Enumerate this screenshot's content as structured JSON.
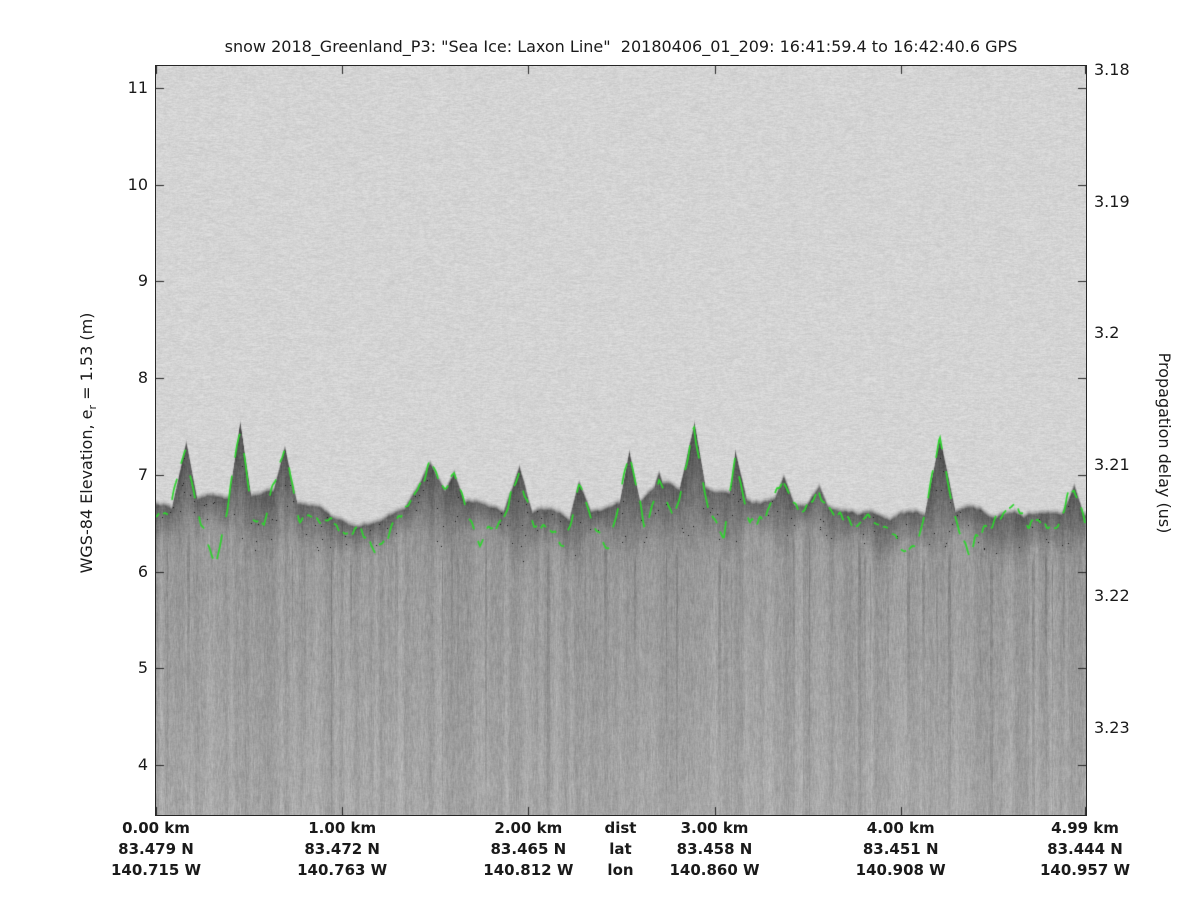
{
  "title": "snow 2018_Greenland_P3: \"Sea Ice: Laxon Line\"  20180406_01_209: 16:41:59.4 to 16:42:40.6 GPS",
  "left_axis": {
    "label_pre": "WGS-84 Elevation, e",
    "label_sub": "r",
    "label_post": " = 1.53 (m)",
    "ticks": [
      {
        "label": "11",
        "value": 11
      },
      {
        "label": "10",
        "value": 10
      },
      {
        "label": "9",
        "value": 9
      },
      {
        "label": "8",
        "value": 8
      },
      {
        "label": "7",
        "value": 7
      },
      {
        "label": "6",
        "value": 6
      },
      {
        "label": "5",
        "value": 5
      },
      {
        "label": "4",
        "value": 4
      }
    ]
  },
  "right_axis": {
    "label": "Propagation delay (us)",
    "ticks": [
      {
        "label": "3.18",
        "value": 3.18
      },
      {
        "label": "3.19",
        "value": 3.19
      },
      {
        "label": "3.2",
        "value": 3.2
      },
      {
        "label": "3.21",
        "value": 3.21
      },
      {
        "label": "3.22",
        "value": 3.22
      },
      {
        "label": "3.23",
        "value": 3.23
      }
    ]
  },
  "x_axis": {
    "header": {
      "km": 2.495,
      "rows": [
        "dist",
        "lat",
        "lon"
      ]
    },
    "columns": [
      {
        "km": 0.0,
        "rows": [
          "0.00 km",
          "83.479 N",
          "140.715 W"
        ]
      },
      {
        "km": 1.0,
        "rows": [
          "1.00 km",
          "83.472 N",
          "140.763 W"
        ]
      },
      {
        "km": 2.0,
        "rows": [
          "2.00 km",
          "83.465 N",
          "140.812 W"
        ]
      },
      {
        "km": 3.0,
        "rows": [
          "3.00 km",
          "83.458 N",
          "140.860 W"
        ]
      },
      {
        "km": 4.0,
        "rows": [
          "4.00 km",
          "83.451 N",
          "140.908 W"
        ]
      },
      {
        "km": 4.99,
        "rows": [
          "4.99 km",
          "83.444 N",
          "140.957 W"
        ]
      }
    ]
  },
  "chart_data": {
    "type": "heatmap",
    "title": "snow 2018_Greenland_P3: \"Sea Ice: Laxon Line\"  20180406_01_209: 16:41:59.4 to 16:42:40.6 GPS",
    "xlabel_rows": [
      "dist",
      "lat",
      "lon"
    ],
    "ylabel_left": "WGS-84 Elevation, e_r = 1.53 (m)",
    "ylabel_right": "Propagation delay (us)",
    "x_axis_km": {
      "min": 0,
      "max": 4.99
    },
    "x_ticks_km": [
      0,
      1,
      2,
      3,
      4,
      4.99
    ],
    "elevation_ticks": [
      11,
      10,
      9,
      8,
      7,
      6,
      5,
      4
    ],
    "elevation_ylim": [
      3.48,
      11.23
    ],
    "delay_ticks": [
      3.18,
      3.19,
      3.2,
      3.21,
      3.22,
      3.23
    ],
    "grid": false,
    "colormap": "1-gray (radar echo power, dark = strong return)",
    "regions": {
      "above_surface_gray": "#d4d4d4",
      "surface_band_gray": "#6e6e6e",
      "below_surface_gray": "#a6a6a6"
    },
    "tracker_color": "#2fd32f",
    "tracker_style": "dashed",
    "surface_profile": [
      [
        0.0,
        6.55
      ],
      [
        0.08,
        6.6
      ],
      [
        0.16,
        7.3
      ],
      [
        0.24,
        6.5
      ],
      [
        0.32,
        6.15
      ],
      [
        0.38,
        6.6
      ],
      [
        0.45,
        7.5
      ],
      [
        0.52,
        6.6
      ],
      [
        0.58,
        6.45
      ],
      [
        0.69,
        7.25
      ],
      [
        0.77,
        6.55
      ],
      [
        0.88,
        6.6
      ],
      [
        0.99,
        6.5
      ],
      [
        1.09,
        6.4
      ],
      [
        1.18,
        6.2
      ],
      [
        1.31,
        6.55
      ],
      [
        1.42,
        6.9
      ],
      [
        1.47,
        7.1
      ],
      [
        1.55,
        6.8
      ],
      [
        1.6,
        7.0
      ],
      [
        1.68,
        6.55
      ],
      [
        1.74,
        6.25
      ],
      [
        1.85,
        6.5
      ],
      [
        1.95,
        7.05
      ],
      [
        2.03,
        6.5
      ],
      [
        2.11,
        6.45
      ],
      [
        2.19,
        6.3
      ],
      [
        2.27,
        6.9
      ],
      [
        2.36,
        6.45
      ],
      [
        2.44,
        6.2
      ],
      [
        2.54,
        7.2
      ],
      [
        2.62,
        6.5
      ],
      [
        2.7,
        7.0
      ],
      [
        2.78,
        6.55
      ],
      [
        2.89,
        7.5
      ],
      [
        2.97,
        6.6
      ],
      [
        3.05,
        6.35
      ],
      [
        3.11,
        7.2
      ],
      [
        3.19,
        6.55
      ],
      [
        3.27,
        6.5
      ],
      [
        3.37,
        6.95
      ],
      [
        3.45,
        6.55
      ],
      [
        3.56,
        6.85
      ],
      [
        3.64,
        6.5
      ],
      [
        3.75,
        6.55
      ],
      [
        3.83,
        6.6
      ],
      [
        3.94,
        6.5
      ],
      [
        4.02,
        6.15
      ],
      [
        4.1,
        6.3
      ],
      [
        4.21,
        7.35
      ],
      [
        4.29,
        6.6
      ],
      [
        4.37,
        6.25
      ],
      [
        4.45,
        6.5
      ],
      [
        4.53,
        6.55
      ],
      [
        4.61,
        6.6
      ],
      [
        4.69,
        6.5
      ],
      [
        4.77,
        6.55
      ],
      [
        4.85,
        6.5
      ],
      [
        4.93,
        6.85
      ],
      [
        4.99,
        6.5
      ]
    ]
  }
}
